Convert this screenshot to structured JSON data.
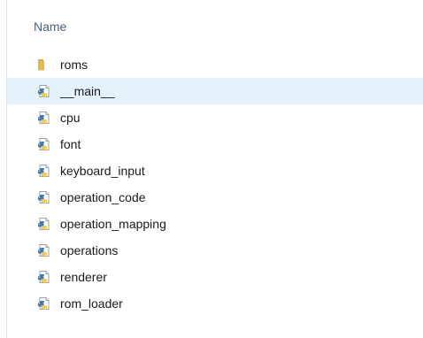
{
  "header": {
    "column_name": "Name"
  },
  "files": [
    {
      "name": "roms",
      "icon": "folder-icon",
      "selected": false
    },
    {
      "name": "__main__",
      "icon": "python-file-icon",
      "selected": true
    },
    {
      "name": "cpu",
      "icon": "python-file-icon",
      "selected": false
    },
    {
      "name": "font",
      "icon": "python-file-icon",
      "selected": false
    },
    {
      "name": "keyboard_input",
      "icon": "python-file-icon",
      "selected": false
    },
    {
      "name": "operation_code",
      "icon": "python-file-icon",
      "selected": false
    },
    {
      "name": "operation_mapping",
      "icon": "python-file-icon",
      "selected": false
    },
    {
      "name": "operations",
      "icon": "python-file-icon",
      "selected": false
    },
    {
      "name": "renderer",
      "icon": "python-file-icon",
      "selected": false
    },
    {
      "name": "rom_loader",
      "icon": "python-file-icon",
      "selected": false
    }
  ],
  "colors": {
    "hover_background": "#e5f1fb",
    "header_text": "#4c607a",
    "folder": "#e8b84a",
    "python_blue": "#3a77b4",
    "python_yellow": "#f2c94c"
  }
}
